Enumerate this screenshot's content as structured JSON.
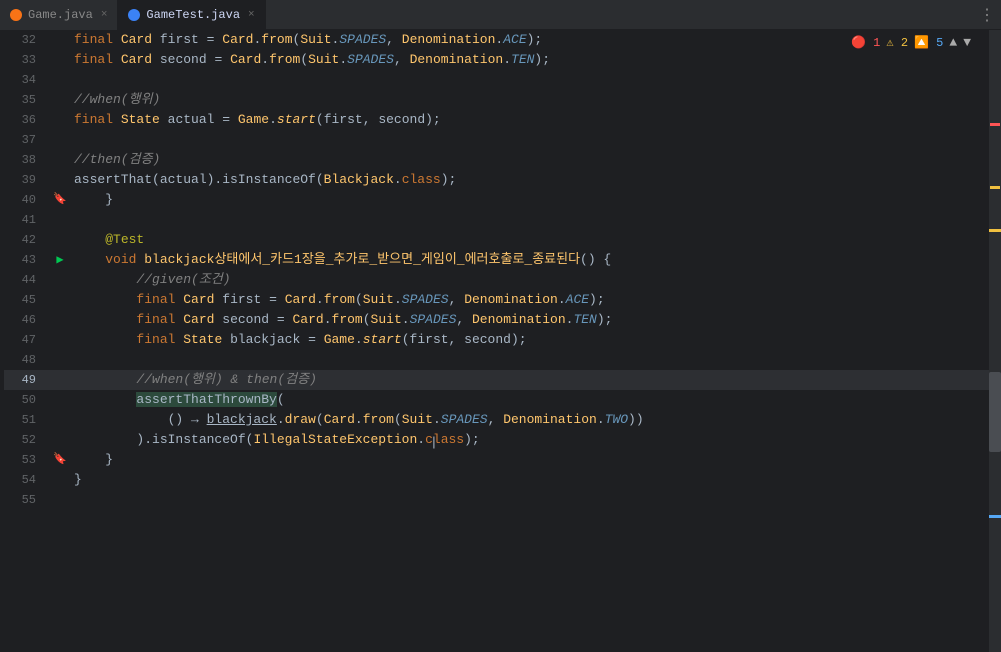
{
  "tabs": [
    {
      "id": "game-java",
      "label": "Game.java",
      "icon": "java",
      "active": false
    },
    {
      "id": "gametest-java",
      "label": "GameTest.java",
      "icon": "test",
      "active": true
    }
  ],
  "status": {
    "errors": "1",
    "warnings": "2",
    "infos": "5"
  },
  "lines": [
    {
      "num": 32,
      "indent": "        ",
      "code": "final Card first = Card.from(Suit.SPADES, Denomination.ACE);",
      "type": "normal"
    },
    {
      "num": 33,
      "indent": "        ",
      "code": "final Card second = Card.from(Suit.SPADES, Denomination.TEN);",
      "type": "normal"
    },
    {
      "num": 34,
      "indent": "",
      "code": "",
      "type": "empty"
    },
    {
      "num": 35,
      "indent": "        ",
      "code": "//when(행위)",
      "type": "comment"
    },
    {
      "num": 36,
      "indent": "        ",
      "code": "final State actual = Game.start(first, second);",
      "type": "normal"
    },
    {
      "num": 37,
      "indent": "",
      "code": "",
      "type": "empty"
    },
    {
      "num": 38,
      "indent": "        ",
      "code": "//then(검증)",
      "type": "comment"
    },
    {
      "num": 39,
      "indent": "        ",
      "code": "assertThat(actual).isInstanceOf(Blackjack.class);",
      "type": "normal"
    },
    {
      "num": 40,
      "indent": "    ",
      "code": "}",
      "type": "brace"
    },
    {
      "num": 41,
      "indent": "",
      "code": "",
      "type": "empty"
    },
    {
      "num": 42,
      "indent": "    ",
      "code": "@Test",
      "type": "annotation"
    },
    {
      "num": 43,
      "indent": "    ",
      "code": "void blackjack상태에서_카드1장을_추가로_받으면_게임이_에러호출로_종료된다() {",
      "type": "method"
    },
    {
      "num": 44,
      "indent": "        ",
      "code": "//given(조건)",
      "type": "comment"
    },
    {
      "num": 45,
      "indent": "        ",
      "code": "final Card first = Card.from(Suit.SPADES, Denomination.ACE);",
      "type": "normal"
    },
    {
      "num": 46,
      "indent": "        ",
      "code": "final Card second = Card.from(Suit.SPADES, Denomination.TEN);",
      "type": "normal"
    },
    {
      "num": 47,
      "indent": "        ",
      "code": "final State blackjack = Game.start(first, second);",
      "type": "normal"
    },
    {
      "num": 48,
      "indent": "",
      "code": "",
      "type": "empty"
    },
    {
      "num": 49,
      "indent": "        ",
      "code": "//when(행위) & then(검증)",
      "type": "comment"
    },
    {
      "num": 50,
      "indent": "        ",
      "code": "assertThatThrownBy(",
      "type": "assert-highlight"
    },
    {
      "num": 51,
      "indent": "            ",
      "code": "() → blackjack.draw(Card.from(Suit.SPADES, Denomination.TWO))",
      "type": "lambda"
    },
    {
      "num": 52,
      "indent": "        ",
      "code": ").isInstanceOf(IllegalStateException.class);",
      "type": "chain"
    },
    {
      "num": 53,
      "indent": "    ",
      "code": "}",
      "type": "brace"
    },
    {
      "num": 54,
      "indent": "",
      "code": "}",
      "type": "brace"
    },
    {
      "num": 55,
      "indent": "",
      "code": "",
      "type": "empty"
    }
  ],
  "cursor_line": 52,
  "active_line": 49
}
